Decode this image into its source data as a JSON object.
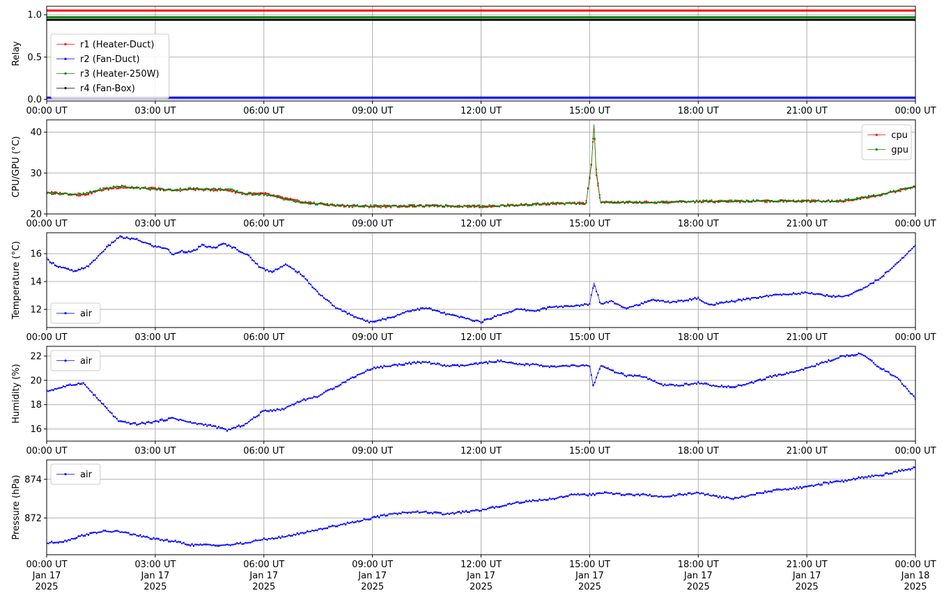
{
  "chart_data": [
    {
      "type": "line",
      "ylabel": "Relay",
      "ylim": [
        -0.02,
        1.1
      ],
      "yticks": [
        0.0,
        0.5,
        1.0
      ],
      "ytick_labels": [
        "0.0",
        "0.5",
        "1.0"
      ],
      "legend_position": "left",
      "grid": true,
      "series": [
        {
          "name": "r1 (Heater-Duct)",
          "color": "#ff0000",
          "values": [
            1.05,
            1.05
          ]
        },
        {
          "name": "r2 (Fan-Duct)",
          "color": "#0000ff",
          "values": [
            0.02,
            0.02
          ]
        },
        {
          "name": "r3 (Heater-250W)",
          "color": "#008000",
          "values": [
            0.97,
            0.97
          ]
        },
        {
          "name": "r4 (Fan-Box)",
          "color": "#000000",
          "values": [
            0.94,
            0.94
          ]
        }
      ]
    },
    {
      "type": "line",
      "ylabel": "CPU/GPU (°C)",
      "ylim": [
        20,
        43
      ],
      "yticks": [
        20,
        30,
        40
      ],
      "ytick_labels": [
        "20",
        "30",
        "40"
      ],
      "legend_position": "top-right",
      "grid": true,
      "x_hours": [
        0,
        1,
        1.5,
        2,
        3,
        3.5,
        4,
        5,
        5.5,
        6,
        7,
        8,
        9,
        10,
        11,
        12,
        13,
        14,
        14.9,
        15.05,
        15.12,
        15.18,
        15.3,
        16,
        17,
        18,
        19,
        20,
        21,
        22,
        23,
        24
      ],
      "series": [
        {
          "name": "cpu",
          "color": "#ff0000",
          "values": [
            25.3,
            24.6,
            25.8,
            26.5,
            26.2,
            25.7,
            26.0,
            25.8,
            24.8,
            25.0,
            23.0,
            22.0,
            21.8,
            21.9,
            22.0,
            21.8,
            22.2,
            22.5,
            22.6,
            32.0,
            41.6,
            30.0,
            22.8,
            22.8,
            22.9,
            23.0,
            23.0,
            23.1,
            23.2,
            23.1,
            24.6,
            26.6
          ]
        },
        {
          "name": "gpu",
          "color": "#008000",
          "values": [
            25.1,
            24.8,
            26.0,
            26.8,
            26.0,
            25.9,
            26.2,
            26.0,
            25.0,
            24.8,
            22.8,
            22.1,
            21.9,
            22.0,
            21.9,
            21.9,
            22.1,
            22.6,
            22.5,
            32.5,
            41.9,
            31.0,
            22.9,
            22.9,
            22.8,
            23.1,
            23.1,
            23.2,
            23.1,
            23.2,
            24.7,
            26.8
          ]
        }
      ]
    },
    {
      "type": "line",
      "ylabel": "Temperature (°C)",
      "ylim": [
        10.7,
        17.5
      ],
      "yticks": [
        12,
        14,
        16
      ],
      "ytick_labels": [
        "12",
        "14",
        "16"
      ],
      "legend_position": "bottom-left",
      "grid": true,
      "x_hours": [
        0,
        0.3,
        0.8,
        1.2,
        1.6,
        2.0,
        2.5,
        3.0,
        3.3,
        3.5,
        3.7,
        4.0,
        4.3,
        4.6,
        4.9,
        5.2,
        5.6,
        5.9,
        6.2,
        6.6,
        7.0,
        7.5,
        8.0,
        8.5,
        8.9,
        9.5,
        10,
        10.5,
        11.0,
        11.5,
        12.0,
        12.5,
        13,
        13.5,
        14,
        14.5,
        15.0,
        15.12,
        15.3,
        15.6,
        16.0,
        16.3,
        16.8,
        17.2,
        17.5,
        18.0,
        18.3,
        19,
        20,
        21,
        21.5,
        22,
        22.5,
        23,
        23.5,
        24
      ],
      "series": [
        {
          "name": "air",
          "color": "#0000ff",
          "values": [
            15.6,
            15.1,
            14.7,
            15.2,
            16.3,
            17.2,
            17.0,
            16.5,
            16.4,
            15.9,
            16.2,
            16.1,
            16.6,
            16.4,
            16.7,
            16.4,
            15.8,
            15.0,
            14.7,
            15.2,
            14.6,
            13.2,
            12.1,
            11.5,
            11.1,
            11.4,
            11.9,
            12.1,
            11.7,
            11.4,
            11.1,
            11.6,
            12.0,
            11.9,
            12.2,
            12.2,
            12.4,
            13.9,
            12.4,
            12.6,
            12.1,
            12.3,
            12.7,
            12.5,
            12.6,
            12.8,
            12.3,
            12.6,
            13.0,
            13.2,
            13.0,
            12.9,
            13.4,
            14.2,
            15.3,
            16.6
          ]
        }
      ]
    },
    {
      "type": "line",
      "ylabel": "Humidity (%)",
      "ylim": [
        15,
        22.8
      ],
      "yticks": [
        16,
        18,
        20,
        22
      ],
      "ytick_labels": [
        "16",
        "18",
        "20",
        "22"
      ],
      "legend_position": "top-left",
      "grid": true,
      "x_hours": [
        0,
        0.5,
        1.0,
        1.5,
        2.0,
        2.5,
        3.0,
        3.5,
        4.0,
        4.5,
        5.0,
        5.5,
        6.0,
        6.5,
        7.0,
        7.5,
        8.0,
        8.5,
        9.0,
        9.5,
        10.0,
        10.5,
        11.0,
        11.5,
        12.0,
        12.5,
        13.0,
        13.5,
        14.0,
        14.5,
        15.0,
        15.1,
        15.3,
        15.6,
        16.0,
        16.5,
        17.0,
        17.5,
        18.0,
        18.5,
        19,
        19.5,
        20,
        20.5,
        21,
        21.5,
        22,
        22.5,
        23,
        23.5,
        24
      ],
      "series": [
        {
          "name": "air",
          "color": "#0000ff",
          "values": [
            19.1,
            19.5,
            19.8,
            18.2,
            16.6,
            16.4,
            16.6,
            16.9,
            16.5,
            16.3,
            15.9,
            16.4,
            17.5,
            17.6,
            18.3,
            18.7,
            19.5,
            20.3,
            21.0,
            21.2,
            21.4,
            21.5,
            21.2,
            21.2,
            21.4,
            21.6,
            21.3,
            21.3,
            21.1,
            21.2,
            21.2,
            19.5,
            21.2,
            20.8,
            20.4,
            20.3,
            19.6,
            19.6,
            19.8,
            19.5,
            19.5,
            19.8,
            20.3,
            20.6,
            21.0,
            21.5,
            22.0,
            22.2,
            21.1,
            20.2,
            18.5
          ]
        }
      ]
    },
    {
      "type": "line",
      "ylabel": "Pressure (hPa)",
      "ylim": [
        870.1,
        875.0
      ],
      "yticks": [
        872,
        874
      ],
      "ytick_labels": [
        "872",
        "874"
      ],
      "legend_position": "top-left",
      "grid": true,
      "x_hours": [
        0,
        0.5,
        1.0,
        1.5,
        2.0,
        2.5,
        3.0,
        3.5,
        4.0,
        4.5,
        5.0,
        5.5,
        6.0,
        6.5,
        7.0,
        7.5,
        8.0,
        8.5,
        9.0,
        9.5,
        10.0,
        10.5,
        11.0,
        11.5,
        12.0,
        12.5,
        13.0,
        13.5,
        14.0,
        14.5,
        15.0,
        15.5,
        16.0,
        16.5,
        17.0,
        17.5,
        18.0,
        18.5,
        19.0,
        19.5,
        20.0,
        20.5,
        21.0,
        21.5,
        22.0,
        22.5,
        23.0,
        23.5,
        24
      ],
      "series": [
        {
          "name": "air",
          "color": "#0000ff",
          "values": [
            870.7,
            870.8,
            871.1,
            871.3,
            871.3,
            871.1,
            870.9,
            870.8,
            870.6,
            870.6,
            870.6,
            870.7,
            870.9,
            871.0,
            871.2,
            871.4,
            871.6,
            871.8,
            872.0,
            872.2,
            872.3,
            872.3,
            872.2,
            872.3,
            872.4,
            872.6,
            872.8,
            872.9,
            873.0,
            873.2,
            873.2,
            873.3,
            873.2,
            873.2,
            873.1,
            873.2,
            873.3,
            873.1,
            873.0,
            873.2,
            873.4,
            873.5,
            873.6,
            873.8,
            873.9,
            874.1,
            874.2,
            874.4,
            874.6
          ]
        }
      ]
    }
  ],
  "x_tick_labels": [
    "00:00 UT",
    "03:00 UT",
    "06:00 UT",
    "09:00 UT",
    "12:00 UT",
    "15:00 UT",
    "18:00 UT",
    "21:00 UT",
    "00:00 UT"
  ],
  "x_date_lines": [
    "Jan 17",
    "Jan 17",
    "Jan 17",
    "Jan 17",
    "Jan 17",
    "Jan 17",
    "Jan 17",
    "Jan 17",
    "Jan 18"
  ],
  "x_year_lines": [
    "2025",
    "2025",
    "2025",
    "2025",
    "2025",
    "2025",
    "2025",
    "2025",
    "2025"
  ],
  "colors": {
    "grid": "#b0b0b0"
  }
}
